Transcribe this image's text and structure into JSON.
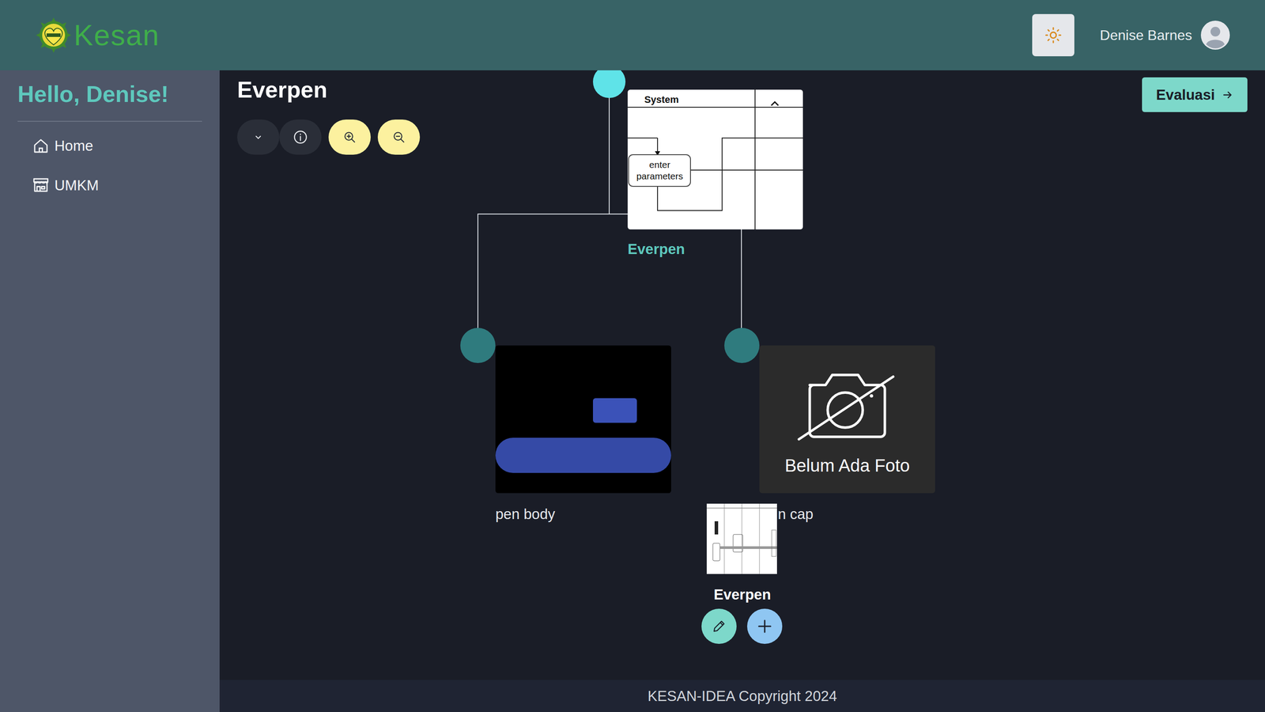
{
  "header": {
    "logo": "Kesan",
    "user": "Denise Barnes"
  },
  "sidebar": {
    "greeting": "Hello, Denise!",
    "items": [
      {
        "label": "Home",
        "selected": false,
        "icon": "home"
      },
      {
        "label": "UMKM",
        "selected": false,
        "icon": "store"
      }
    ]
  },
  "page": {
    "title": "Everpen",
    "evaluate_button": "Evaluasi"
  },
  "tree": {
    "root": {
      "label": "Everpen",
      "thumbnail": {
        "title": "System",
        "step": "enter parameters"
      }
    },
    "children": [
      {
        "label": "pen body",
        "kind": "photo"
      },
      {
        "label": "n cap",
        "kind": "placeholder",
        "placeholder": "Belum Ada Foto"
      }
    ]
  },
  "popup": {
    "title": "Everpen"
  },
  "footer": "KESAN-IDEA Copyright 2024"
}
